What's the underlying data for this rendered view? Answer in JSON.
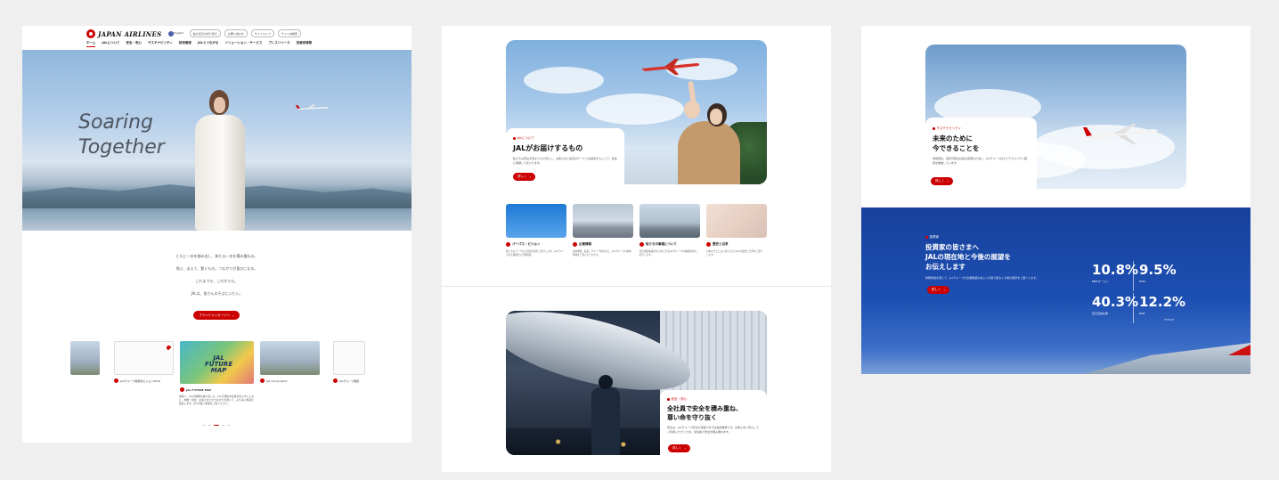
{
  "panel1": {
    "logo_text": "JAPAN AIRLINES",
    "utility_links": [
      "English",
      "拡大表示の切り替え",
      "お問い合わせ",
      "サイトマップ",
      "サイト内検索"
    ],
    "nav_items": [
      "ホーム",
      "JALについて",
      "安全・安心",
      "サステナビリティ",
      "採用情報",
      "JALとつながる",
      "ソリューション・サービス",
      "プレスリリース",
      "投資家情報"
    ],
    "hero_title_line1": "Soaring",
    "hero_title_line2": "Together",
    "copy_lines": [
      "ともに一歩を踏み出し、新たな一歩を積み重ねる。",
      "飛ぶ、支えて、繋ぐもの。つながりが喜びになる。",
      "これまでも、これからも。",
      "JALは、皆さんのそばにいたい。"
    ],
    "brand_button": "ブランドメッセージへ",
    "carousel_captions": [
      "JALグループ新統合ビジョン2030",
      "JAL FUTURE MAP",
      "JAL Group Spirit",
      "JALグループ理念"
    ],
    "map_logo_line1": "JAL",
    "map_logo_line2": "FUTURE",
    "map_logo_line3": "MAP",
    "featured_desc": "未来へ、JALの挑戦を描きました。JALが目指す社会を皆さまとともに。地域・社会・お客さまとのつながりを通じて、より良い未来を創造します。JALが描く未来をご覧ください。"
  },
  "panel2": {
    "section1": {
      "tag": "JALについて",
      "title": "JALがお届けするもの",
      "body": "私たちは安全を何よりも大切にし、お客さまに最高のサービスを提供することで、社会に貢献してまいります。",
      "button": "詳しく"
    },
    "tiles": [
      {
        "label": "パーパス・ビジョン",
        "desc": "私たちのパーパスと目指す姿をご紹介します。JALグループの企業理念と行動指針。"
      },
      {
        "label": "企業情報",
        "desc": "会社概要、役員、グループ会社など、JALグループの基本情報をご覧いただけます。"
      },
      {
        "label": "私たちの事業について",
        "desc": "航空運送事業をはじめとするJALグループの事業内容をご紹介します。"
      },
      {
        "label": "歴史と沿革",
        "desc": "日本の空とともに歩んできたJALの歴史と沿革をご紹介します。"
      }
    ],
    "section2": {
      "tag": "安全・安心",
      "title_line1": "全社員で安全を積み重ね、",
      "title_line2": "尊い命を守り抜く",
      "body": "安全は、JALグループ存立の基盤であり社会的責務です。お客さまに安心してご利用いただくため、全社員で安全を積み重ねます。",
      "button": "詳しく"
    }
  },
  "panel3": {
    "section1": {
      "tag": "サステナビリティ",
      "title_line1": "未来のために",
      "title_line2": "今できることを",
      "body": "地球環境、持続可能な社会の実現のために、JALグループはサステナビリティ経営を推進しています。",
      "button": "詳しく"
    },
    "investor": {
      "tag": "投資家",
      "title_line1": "投資家の皆さまへ",
      "title_line2": "JALの現在地と今後の展望を",
      "title_line3": "お伝えします",
      "body": "財務情報を通じて、JALグループの企業価値の向上への取り組みと今後の展望をご紹介します。",
      "button": "詳しく",
      "stats": [
        {
          "value": "10.8%",
          "label": "EBITマージン"
        },
        {
          "value": "9.5%",
          "label": "ROIC"
        },
        {
          "value": "40.3%",
          "label": "自己資本比率"
        },
        {
          "value": "12.2%",
          "label": "ROE"
        }
      ],
      "fiscal_note": "FY2023"
    }
  },
  "colors": {
    "brand_red": "#cc0000",
    "investor_blue": "#1d4fb3",
    "background": "#efefef"
  }
}
